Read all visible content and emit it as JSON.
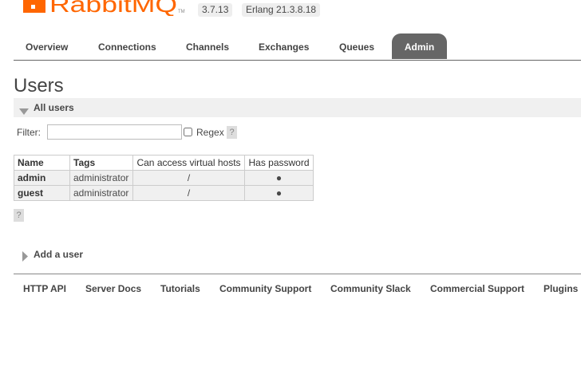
{
  "header": {
    "logo_text": "RabbitMQ",
    "logo_tm": "TM",
    "version": "3.7.13",
    "erlang": "Erlang 21.3.8.18"
  },
  "tabs": [
    {
      "label": "Overview"
    },
    {
      "label": "Connections"
    },
    {
      "label": "Channels"
    },
    {
      "label": "Exchanges"
    },
    {
      "label": "Queues"
    },
    {
      "label": "Admin",
      "selected": true
    }
  ],
  "page_title": "Users",
  "all_users": {
    "heading": "All users",
    "filter_label": "Filter:",
    "filter_value": "",
    "regex_label": "Regex",
    "regex_checked": false,
    "help": "?",
    "columns": [
      "Name",
      "Tags",
      "Can access virtual hosts",
      "Has password"
    ],
    "rows": [
      {
        "name": "admin",
        "tags": "administrator",
        "vhosts": "/",
        "has_password": "●"
      },
      {
        "name": "guest",
        "tags": "administrator",
        "vhosts": "/",
        "has_password": "●"
      }
    ]
  },
  "add_user": {
    "heading": "Add a user"
  },
  "footer": {
    "links": [
      "HTTP API",
      "Server Docs",
      "Tutorials",
      "Community Support",
      "Community Slack",
      "Commercial Support",
      "Plugins"
    ]
  },
  "colors": {
    "brand": "#f60",
    "tab_selected_bg": "#666",
    "section_bg": "#f0f0f0"
  }
}
